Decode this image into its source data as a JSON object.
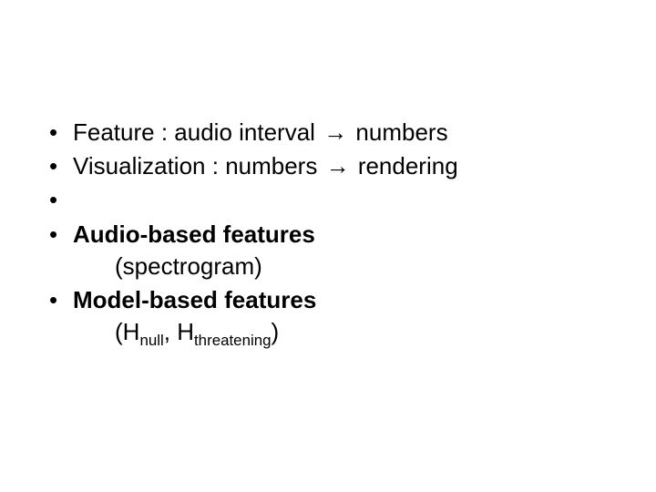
{
  "bullets": {
    "b1": {
      "term": "Feature",
      "sep": " : ",
      "from": "audio interval",
      "arrow": "→",
      "to": "numbers"
    },
    "b2": {
      "term": "Visualization",
      "sep": " : ",
      "from": "numbers",
      "arrow": "→",
      "to": "rendering"
    },
    "b3": {
      "title": "Audio-based features",
      "sub": "(spectrogram)"
    },
    "b4": {
      "title": "Model-based features",
      "sub_open": "(",
      "h1_base": "H",
      "h1_sub": "null",
      "comma": ", ",
      "h2_base": "H",
      "h2_sub": "threatening",
      "sub_close": ")"
    }
  }
}
